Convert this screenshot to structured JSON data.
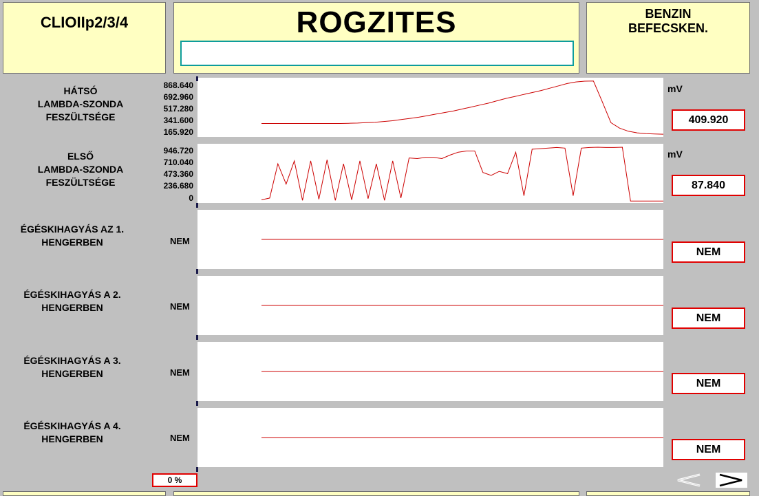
{
  "header": {
    "model": "CLIOIIp2/3/4",
    "title": "ROGZITES",
    "title_input_value": "",
    "system_line1": "BENZIN",
    "system_line2": "BEFECSKEN."
  },
  "channels": [
    {
      "label_lines": [
        "HÁTSÓ",
        "LAMBDA-SZONDA",
        "FESZÜLTSÉGE"
      ],
      "ticks": [
        "868.640",
        "692.960",
        "517.280",
        "341.600",
        "165.920"
      ],
      "unit": "mV",
      "current_value": "409.920"
    },
    {
      "label_lines": [
        "ELSŐ",
        "LAMBDA-SZONDA",
        "FESZÜLTSÉGE"
      ],
      "ticks": [
        "946.720",
        "710.040",
        "473.360",
        "236.680",
        "0"
      ],
      "unit": "mV",
      "current_value": "87.840"
    },
    {
      "label_lines": [
        "ÉGÉSKIHAGYÁS AZ 1.",
        "HENGERBEN"
      ],
      "tick": "NEM",
      "current_value": "NEM"
    },
    {
      "label_lines": [
        "ÉGÉSKIHAGYÁS A 2.",
        "HENGERBEN"
      ],
      "tick": "NEM",
      "current_value": "NEM"
    },
    {
      "label_lines": [
        "ÉGÉSKIHAGYÁS A 3.",
        "HENGERBEN"
      ],
      "tick": "NEM",
      "current_value": "NEM"
    },
    {
      "label_lines": [
        "ÉGÉSKIHAGYÁS A 4.",
        "HENGERBEN"
      ],
      "tick": "NEM",
      "current_value": "NEM"
    }
  ],
  "progress": {
    "text": "0 %",
    "value": 0
  },
  "nav": {
    "prev_icon": "chevron-left-icon",
    "next_icon": "chevron-right-icon"
  },
  "colors": {
    "trace": "#cc0000",
    "panel": "#ffffc2",
    "background": "#c0c0c0",
    "value_border": "#e00000",
    "input_border": "#0d9c9c"
  },
  "chart_data": [
    {
      "type": "line",
      "ylabel": "mV",
      "ylim": [
        165.92,
        868.64
      ],
      "series": [
        {
          "values": [
            320,
            320,
            320,
            320,
            320,
            320,
            320,
            320,
            320,
            320,
            322,
            325,
            330,
            335,
            345,
            355,
            370,
            385,
            400,
            420,
            440,
            460,
            480,
            505,
            530,
            555,
            580,
            610,
            640,
            665,
            690,
            715,
            740,
            770,
            800,
            830,
            850,
            860,
            862,
            600,
            330,
            260,
            220,
            200,
            190,
            185,
            183
          ]
        }
      ]
    },
    {
      "type": "line",
      "ylabel": "mV",
      "ylim": [
        0,
        946.72
      ],
      "series": [
        {
          "values": [
            30,
            60,
            650,
            300,
            700,
            20,
            700,
            40,
            720,
            20,
            650,
            30,
            700,
            50,
            650,
            20,
            700,
            60,
            750,
            740,
            760,
            760,
            740,
            800,
            850,
            870,
            870,
            500,
            450,
            520,
            480,
            850,
            100,
            900,
            910,
            920,
            930,
            920,
            100,
            920,
            930,
            935,
            930,
            930,
            935,
            10,
            10,
            10,
            10,
            10
          ]
        }
      ]
    }
  ]
}
